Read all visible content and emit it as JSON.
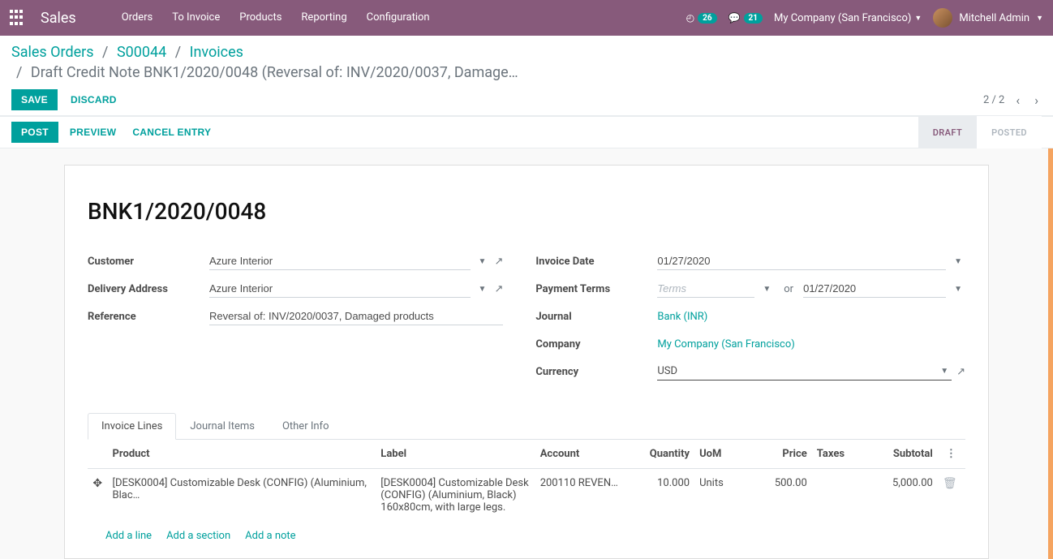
{
  "nav": {
    "brand": "Sales",
    "items": [
      "Orders",
      "To Invoice",
      "Products",
      "Reporting",
      "Configuration"
    ],
    "activity_count": "26",
    "discuss_count": "21",
    "company": "My Company (San Francisco)",
    "user": "Mitchell Admin"
  },
  "breadcrumb": {
    "root": "Sales Orders",
    "order": "S00044",
    "invoices": "Invoices",
    "current": "Draft Credit Note BNK1/2020/0048 (Reversal of: INV/2020/0037, Damage…"
  },
  "actions": {
    "save": "Save",
    "discard": "Discard",
    "pager": "2 / 2"
  },
  "statusbar": {
    "post": "Post",
    "preview": "Preview",
    "cancel": "Cancel Entry",
    "draft": "Draft",
    "posted": "Posted"
  },
  "doc": {
    "name": "BNK1/2020/0048",
    "labels": {
      "customer": "Customer",
      "delivery": "Delivery Address",
      "reference": "Reference",
      "invoice_date": "Invoice Date",
      "payment_terms": "Payment Terms",
      "or": "or",
      "journal": "Journal",
      "company": "Company",
      "currency": "Currency"
    },
    "customer": "Azure Interior",
    "delivery": "Azure Interior",
    "reference": "Reversal of: INV/2020/0037, Damaged products",
    "invoice_date": "01/27/2020",
    "payment_terms_placeholder": "Terms",
    "due_date": "01/27/2020",
    "journal": "Bank (INR)",
    "company": "My Company (San Francisco)",
    "currency": "USD"
  },
  "tabs": {
    "invoice_lines": "Invoice Lines",
    "journal_items": "Journal Items",
    "other_info": "Other Info"
  },
  "table": {
    "headers": {
      "product": "Product",
      "label": "Label",
      "account": "Account",
      "quantity": "Quantity",
      "uom": "UoM",
      "price": "Price",
      "taxes": "Taxes",
      "subtotal": "Subtotal"
    },
    "row": {
      "product": "[DESK0004] Customizable Desk (CONFIG) (Aluminium, Blac…",
      "label": "[DESK0004] Customizable Desk (CONFIG) (Aluminium, Black) 160x80cm, with large legs.",
      "account": "200110 REVEN…",
      "quantity": "10.000",
      "uom": "Units",
      "price": "500.00",
      "taxes": "",
      "subtotal": "5,000.00"
    },
    "add_line": "Add a line",
    "add_section": "Add a section",
    "add_note": "Add a note"
  }
}
